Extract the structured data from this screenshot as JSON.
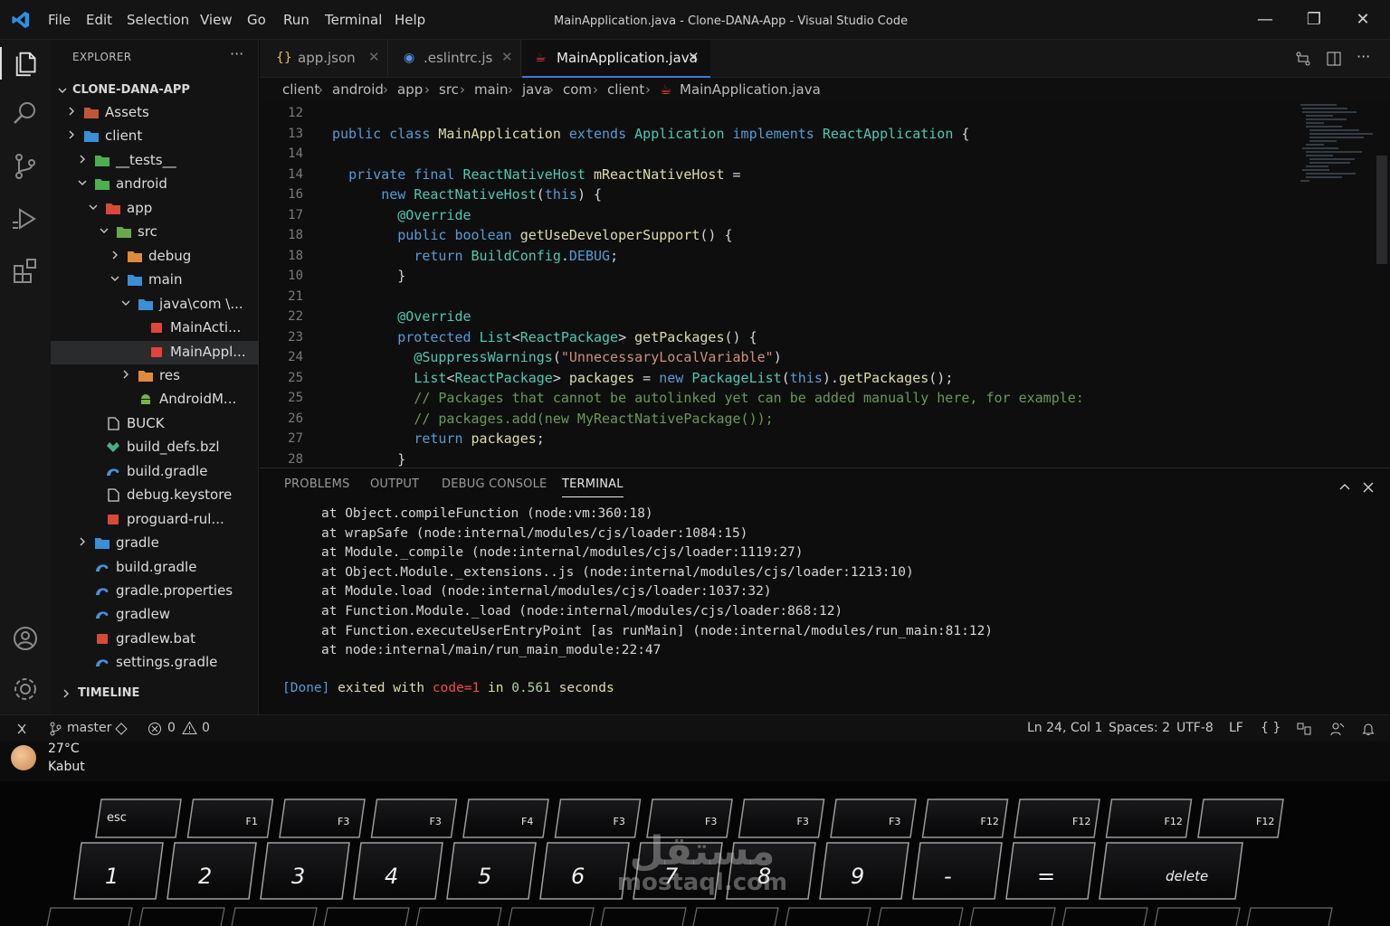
{
  "titlebar": {
    "menus": [
      "File",
      "Edit",
      "Selection",
      "View",
      "Go",
      "Run",
      "Terminal",
      "Help"
    ],
    "title": "MainApplication.java - Clone-DANA-App - Visual Studio Code",
    "min": "—",
    "max": "❐",
    "close": "✕"
  },
  "sidebar": {
    "title": "EXPLORER",
    "more": "···",
    "project": "CLONE-DANA-APP",
    "items": [
      {
        "label": "Assets",
        "icon": "folder-icon"
      },
      {
        "label": "client",
        "icon": "folder-icon"
      },
      {
        "label": "__tests__",
        "icon": "folder-icon"
      },
      {
        "label": "android",
        "icon": "folder-icon"
      },
      {
        "label": "app",
        "icon": "folder-icon"
      },
      {
        "label": "src",
        "icon": "folder-icon"
      },
      {
        "label": "debug",
        "icon": "folder-icon"
      },
      {
        "label": "main",
        "icon": "folder-icon"
      },
      {
        "label": "java\\com \\...",
        "icon": "folder-icon"
      },
      {
        "label": "MainActi...",
        "icon": "java-file-icon"
      },
      {
        "label": "MainAppl...",
        "icon": "java-file-icon"
      },
      {
        "label": "res",
        "icon": "folder-icon"
      },
      {
        "label": "AndroidM...",
        "icon": "android-icon"
      },
      {
        "label": "BUCK",
        "icon": "file-icon"
      },
      {
        "label": "build_defs.bzl",
        "icon": "bazel-icon"
      },
      {
        "label": "build.gradle",
        "icon": "gradle-icon"
      },
      {
        "label": "debug.keystore",
        "icon": "file-icon"
      },
      {
        "label": "proguard-rul...",
        "icon": "proguard-icon"
      },
      {
        "label": "gradle",
        "icon": "folder-icon"
      },
      {
        "label": "build.gradle",
        "icon": "gradle-icon"
      },
      {
        "label": "gradle.properties",
        "icon": "gradle-icon"
      },
      {
        "label": "gradlew",
        "icon": "gradle-icon"
      },
      {
        "label": "gradlew.bat",
        "icon": "bat-icon"
      },
      {
        "label": "settings.gradle",
        "icon": "gradle-icon"
      }
    ],
    "timeline": "TIMELINE"
  },
  "tabs": [
    {
      "label": "app.json",
      "icon": "{}"
    },
    {
      "label": ".eslintrc.js",
      "icon": "◉"
    },
    {
      "label": "MainApplication.java",
      "icon": "☕"
    }
  ],
  "breadcrumb": [
    "client",
    "android",
    "app",
    "src",
    "main",
    "java",
    "com",
    "client",
    "MainApplication.java"
  ],
  "editor": {
    "line_numbers": [
      "12",
      "13",
      "14",
      "14",
      "16",
      "17",
      "18",
      "18",
      "10",
      "21",
      "22",
      "23",
      "24",
      "25",
      "25",
      "26",
      "27",
      "28"
    ],
    "lines": [
      "",
      "public class MainApplication extends Application implements ReactApplication {",
      "",
      "  private final ReactNativeHost mReactNativeHost =",
      "      new ReactNativeHost(this) {",
      "        @Override",
      "        public boolean getUseDeveloperSupport() {",
      "          return BuildConfig.DEBUG;",
      "        }",
      "",
      "        @Override",
      "        protected List<ReactPackage> getPackages() {",
      "          @SuppressWarnings(\"UnnecessaryLocalVariable\")",
      "          List<ReactPackage> packages = new PackageList(this).getPackages();",
      "          // Packages that cannot be autolinked yet can be added manually here, for example:",
      "          // packages.add(new MyReactNativePackage());",
      "          return packages;",
      "        }"
    ]
  },
  "panel": {
    "tabs": [
      "PROBLEMS",
      "OUTPUT",
      "DEBUG CONSOLE",
      "TERMINAL"
    ],
    "terminal_lines": [
      "at Object.compileFunction (node:vm:360:18)",
      "at wrapSafe (node:internal/modules/cjs/loader:1084:15)",
      "at Module._compile (node:internal/modules/cjs/loader:1119:27)",
      "at Object.Module._extensions..js (node:internal/modules/cjs/loader:1213:10)",
      "at Module.load (node:internal/modules/cjs/loader:1037:32)",
      "at Function.Module._load (node:internal/modules/cjs/loader:868:12)",
      "at Function.executeUserEntryPoint [as runMain] (node:internal/modules/run_main:81:12)",
      "at node:internal/main/run_main_module:22:47"
    ],
    "done": {
      "tag": "[Done]",
      "exited": "exited with",
      "code": "code=1",
      "in": "in",
      "time": "0.561",
      "seconds": "seconds"
    }
  },
  "statusbar": {
    "branch": "master",
    "errors": "0",
    "warnings": "0",
    "position": "Ln 24, Col 1",
    "spaces": "Spaces: 2",
    "encoding": "UTF-8",
    "eol": "LF",
    "lang": "{ }"
  },
  "taskbar": {
    "temp": "27°C",
    "condition": "Kabut"
  },
  "keyboard": {
    "fn_row": [
      "esc",
      "F1",
      "F3",
      "F3",
      "F4",
      "F3",
      "F3",
      "F3",
      "F3",
      "F12",
      "F12",
      "F12",
      "F12"
    ],
    "num_row": [
      "1",
      "2",
      "3",
      "4",
      "5",
      "6",
      "7",
      "8",
      "9",
      "-",
      "=",
      "delete"
    ]
  },
  "watermark": {
    "arabic": "مستقل",
    "latin": "mostaql.com"
  }
}
